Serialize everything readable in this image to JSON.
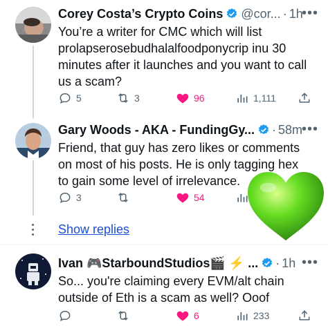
{
  "tweets": [
    {
      "name": "Corey Costa’s Crypto Coins",
      "handle": "@cor...",
      "time": "1h",
      "text": "You’re a writer for CMC which will list prolapserosebudhalalfoodponycrip inu 30 minutes after it launches and you want to call us a scam?",
      "replies": "5",
      "retweets": "3",
      "likes": "96",
      "views": "1,111"
    },
    {
      "name": "Gary Woods - AKA - FundingGy...",
      "handle": "",
      "time": "58m",
      "text": "Friend, that guy has zero likes or comments on most of his posts. He is only tagging hex to gain some level of irrelevance.",
      "replies": "3",
      "retweets": "",
      "likes": "54",
      "views": ""
    },
    {
      "name": "Ivan 🎮StarboundStudios🎬 ⚡ ...",
      "handle": "",
      "time": "1h",
      "text": "So... you're claiming every EVM/alt chain outside of Eth is a scam as well? Ooof",
      "replies": "",
      "retweets": "",
      "likes": "6",
      "views": "233"
    }
  ],
  "show_replies_label": "Show replies",
  "more_label": "•••",
  "colors": {
    "verified": "#1d9bf0",
    "like": "#f91880",
    "link": "#1d4ed8",
    "muted": "#536471",
    "heart_green": "#66dd22"
  },
  "icons": [
    "reply-icon",
    "retweet-icon",
    "like-icon",
    "views-icon",
    "share-icon",
    "verified-icon",
    "more-icon",
    "green-heart-emoji"
  ]
}
